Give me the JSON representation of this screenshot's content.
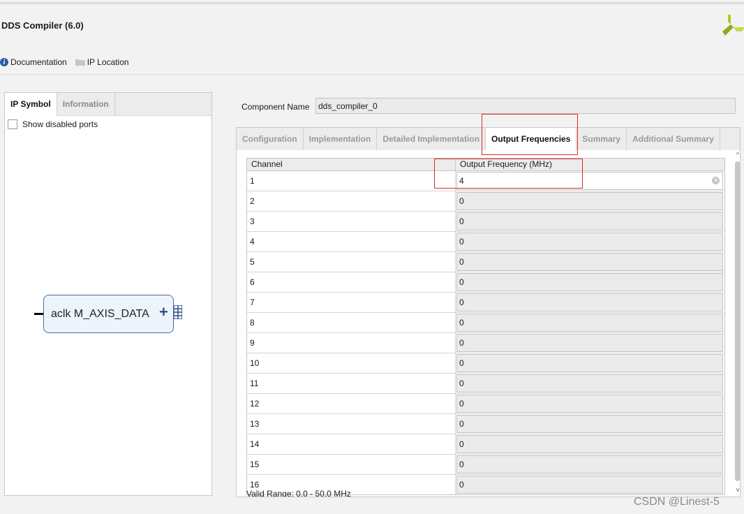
{
  "window": {
    "title": "DDS Compiler (6.0)"
  },
  "toolbar": {
    "documentation": "Documentation",
    "ip_location": "IP Location"
  },
  "left_panel": {
    "tabs": [
      {
        "label": "IP Symbol"
      },
      {
        "label": "Information"
      }
    ],
    "show_disabled_ports": "Show disabled ports",
    "symbol": {
      "text": "aclk M_AXIS_DATA",
      "plus": "+"
    }
  },
  "component": {
    "label": "Component Name",
    "value": "dds_compiler_0"
  },
  "right_tabs": [
    {
      "label": "Configuration"
    },
    {
      "label": "Implementation"
    },
    {
      "label": "Detailed Implementation"
    },
    {
      "label": "Output Frequencies"
    },
    {
      "label": "Summary"
    },
    {
      "label": "Additional Summary"
    }
  ],
  "table": {
    "headers": [
      "Channel",
      "Output Frequency (MHz)"
    ],
    "rows": [
      {
        "channel": "1",
        "freq": "4"
      },
      {
        "channel": "2",
        "freq": "0"
      },
      {
        "channel": "3",
        "freq": "0"
      },
      {
        "channel": "4",
        "freq": "0"
      },
      {
        "channel": "5",
        "freq": "0"
      },
      {
        "channel": "6",
        "freq": "0"
      },
      {
        "channel": "7",
        "freq": "0"
      },
      {
        "channel": "8",
        "freq": "0"
      },
      {
        "channel": "9",
        "freq": "0"
      },
      {
        "channel": "10",
        "freq": "0"
      },
      {
        "channel": "11",
        "freq": "0"
      },
      {
        "channel": "12",
        "freq": "0"
      },
      {
        "channel": "13",
        "freq": "0"
      },
      {
        "channel": "14",
        "freq": "0"
      },
      {
        "channel": "15",
        "freq": "0"
      },
      {
        "channel": "16",
        "freq": "0"
      }
    ]
  },
  "valid_range": "Valid Range: 0.0 - 50.0 MHz",
  "watermark": "CSDN @Linest-5",
  "colors": {
    "accent": "#2d5ca8",
    "highlight": "#e02828"
  }
}
